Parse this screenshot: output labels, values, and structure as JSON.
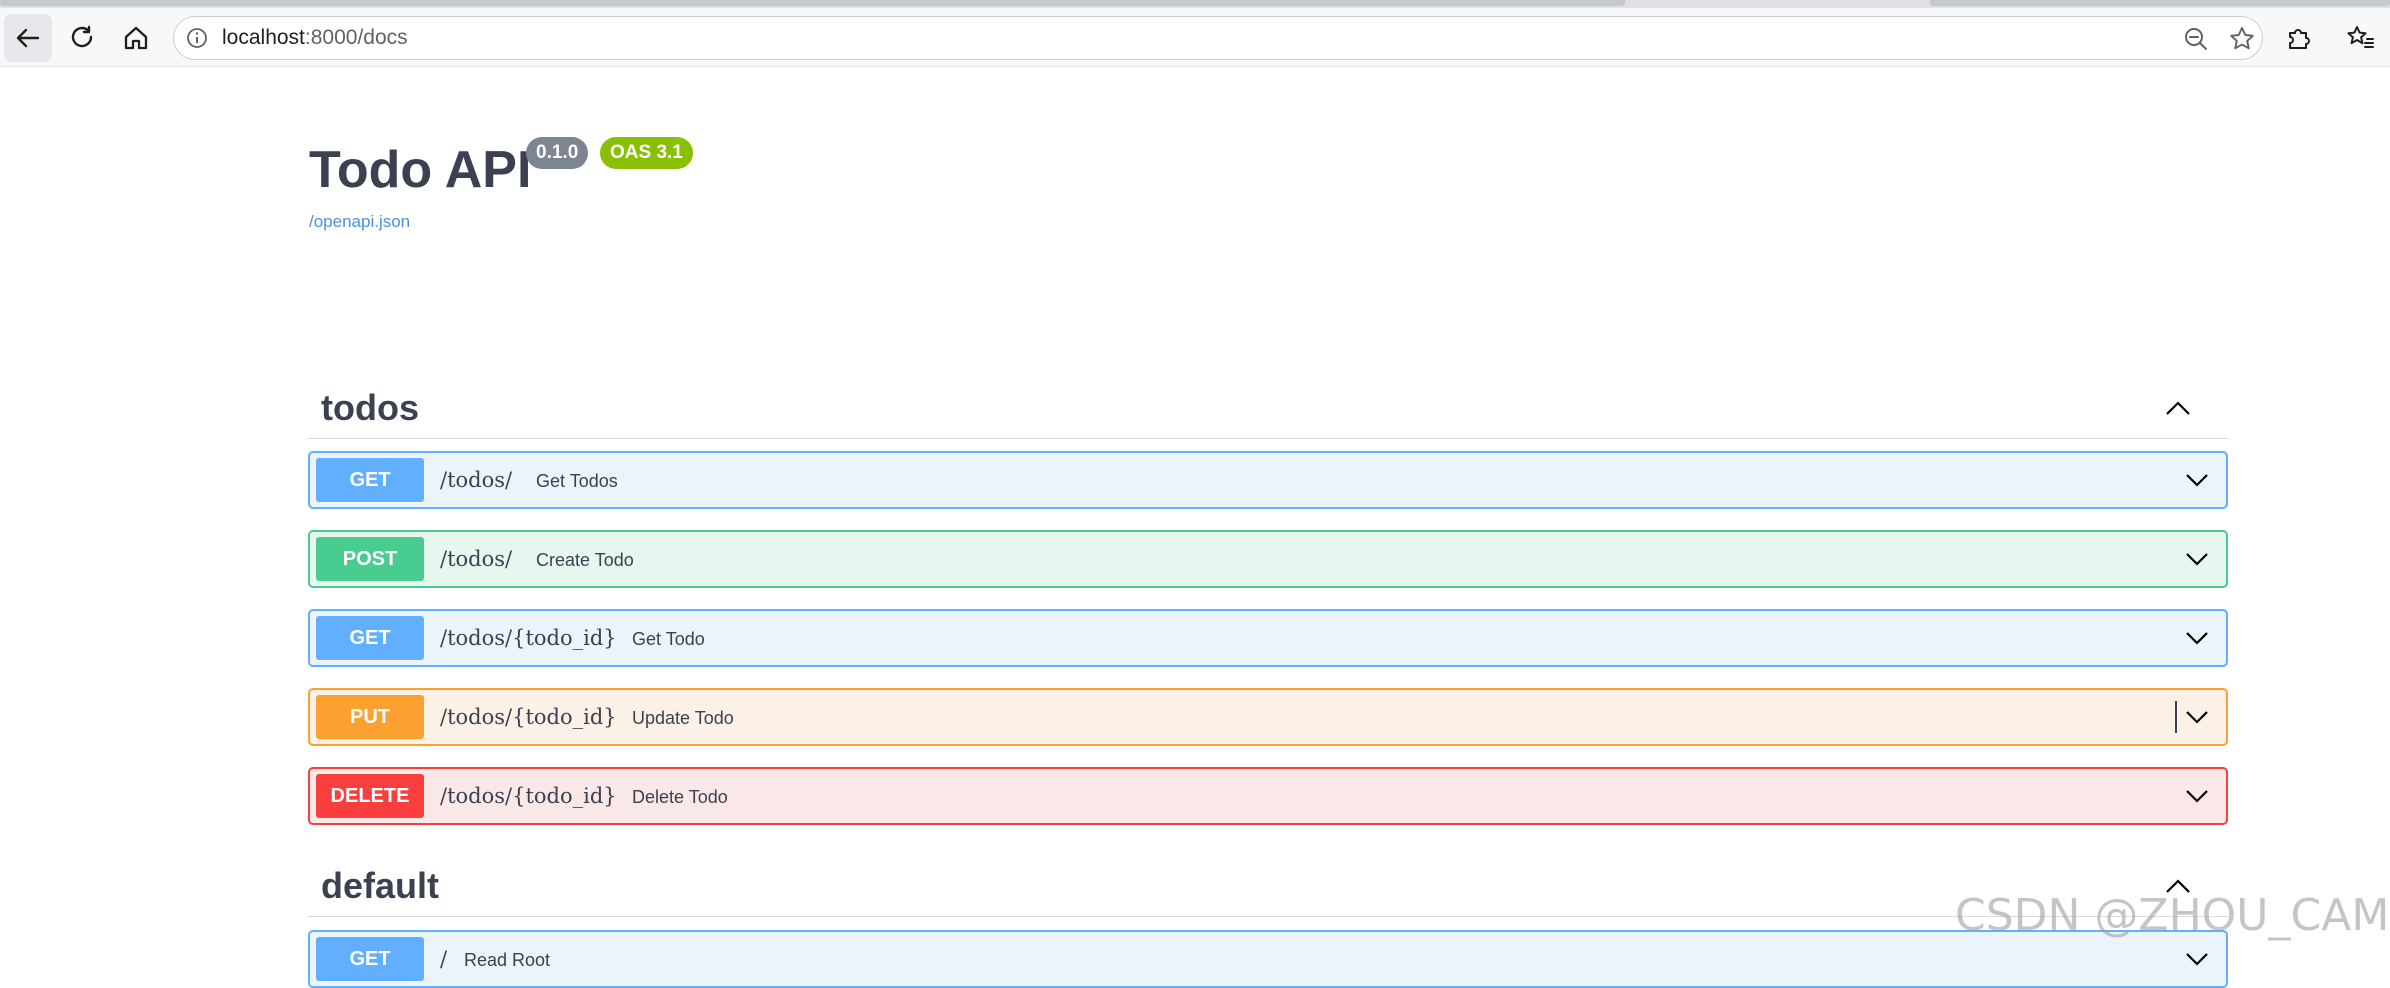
{
  "browser": {
    "url_host": "localhost",
    "url_path": ":8000/docs",
    "icons": {
      "back": "arrow-left-icon",
      "reload": "reload-icon",
      "home": "home-icon",
      "info": "info-icon",
      "zoom": "zoom-out-icon",
      "bookmark": "star-icon",
      "extensions": "puzzle-icon",
      "favorites": "favorites-icon"
    }
  },
  "api": {
    "title": "Todo API",
    "version_badge": "0.1.0",
    "oas_badge": "OAS 3.1",
    "spec_link": "/openapi.json"
  },
  "tags": [
    {
      "name": "todos",
      "operations": [
        {
          "method": "GET",
          "path": "/todos/",
          "summary": "Get Todos"
        },
        {
          "method": "POST",
          "path": "/todos/",
          "summary": "Create Todo"
        },
        {
          "method": "GET",
          "path": "/todos/{todo_id}",
          "summary": "Get Todo"
        },
        {
          "method": "PUT",
          "path": "/todos/{todo_id}",
          "summary": "Update Todo"
        },
        {
          "method": "DELETE",
          "path": "/todos/{todo_id}",
          "summary": "Delete Todo"
        }
      ]
    },
    {
      "name": "default",
      "operations": [
        {
          "method": "GET",
          "path": "/",
          "summary": "Read Root"
        }
      ]
    }
  ],
  "colors": {
    "get": "#61affe",
    "post": "#49cc90",
    "put": "#fca130",
    "delete": "#f93e3e",
    "version_badge": "#7d8492",
    "oas_badge": "#89bf04"
  },
  "watermark": "CSDN @ZHOU_CAMP"
}
